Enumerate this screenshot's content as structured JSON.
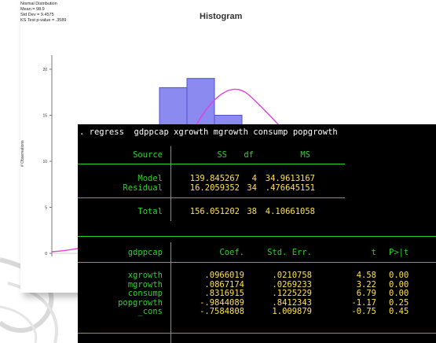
{
  "histogram": {
    "stats": [
      "Normal Distribution",
      "Mean = 98.9",
      "Std Dev = 9.4575",
      "KS Test p-value = .3589"
    ],
    "title": "Histogram",
    "y_axis_label": "# Observations",
    "bar_color": "#8a8af0",
    "curve_color": "#e040e0",
    "chart_data": {
      "type": "bar",
      "values": [
        18,
        19,
        15
      ],
      "yticks": [
        "20",
        "15",
        "10",
        "5",
        "0"
      ],
      "ylim": [
        0,
        20
      ]
    }
  },
  "console": {
    "command": ". regress  gdppcap xgrowth mgrowth consump popgrowth",
    "anova": {
      "headers": {
        "source": "Source",
        "ss": "SS",
        "df": "df",
        "ms": "MS"
      },
      "rows": [
        {
          "source": "Model",
          "ss": "139.845267",
          "df": "4",
          "ms": "34.9613167"
        },
        {
          "source": "Residual",
          "ss": "16.2059352",
          "df": "34",
          "ms": ".476645151"
        }
      ],
      "total": {
        "source": "Total",
        "ss": "156.051202",
        "df": "38",
        "ms": "4.10661058"
      }
    },
    "coef": {
      "headers": {
        "var": "gdppcap",
        "coef": "Coef.",
        "se": "Std. Err.",
        "t": "t",
        "p": "P>|t"
      },
      "rows": [
        {
          "var": "xgrowth",
          "coef": ".0966019",
          "se": ".0210758",
          "t": "4.58",
          "p": "0.00"
        },
        {
          "var": "mgrowth",
          "coef": ".0867174",
          "se": ".0269233",
          "t": "3.22",
          "p": "0.00"
        },
        {
          "var": "consump",
          "coef": ".8316915",
          "se": ".1225229",
          "t": "6.79",
          "p": "0.00"
        },
        {
          "var": "popgrowth",
          "coef": "-.9844089",
          "se": ".8412343",
          "t": "-1.17",
          "p": "0.25"
        },
        {
          "var": "_cons",
          "coef": "-.7584808",
          "se": "1.009879",
          "t": "-0.75",
          "p": "0.45"
        }
      ]
    }
  }
}
